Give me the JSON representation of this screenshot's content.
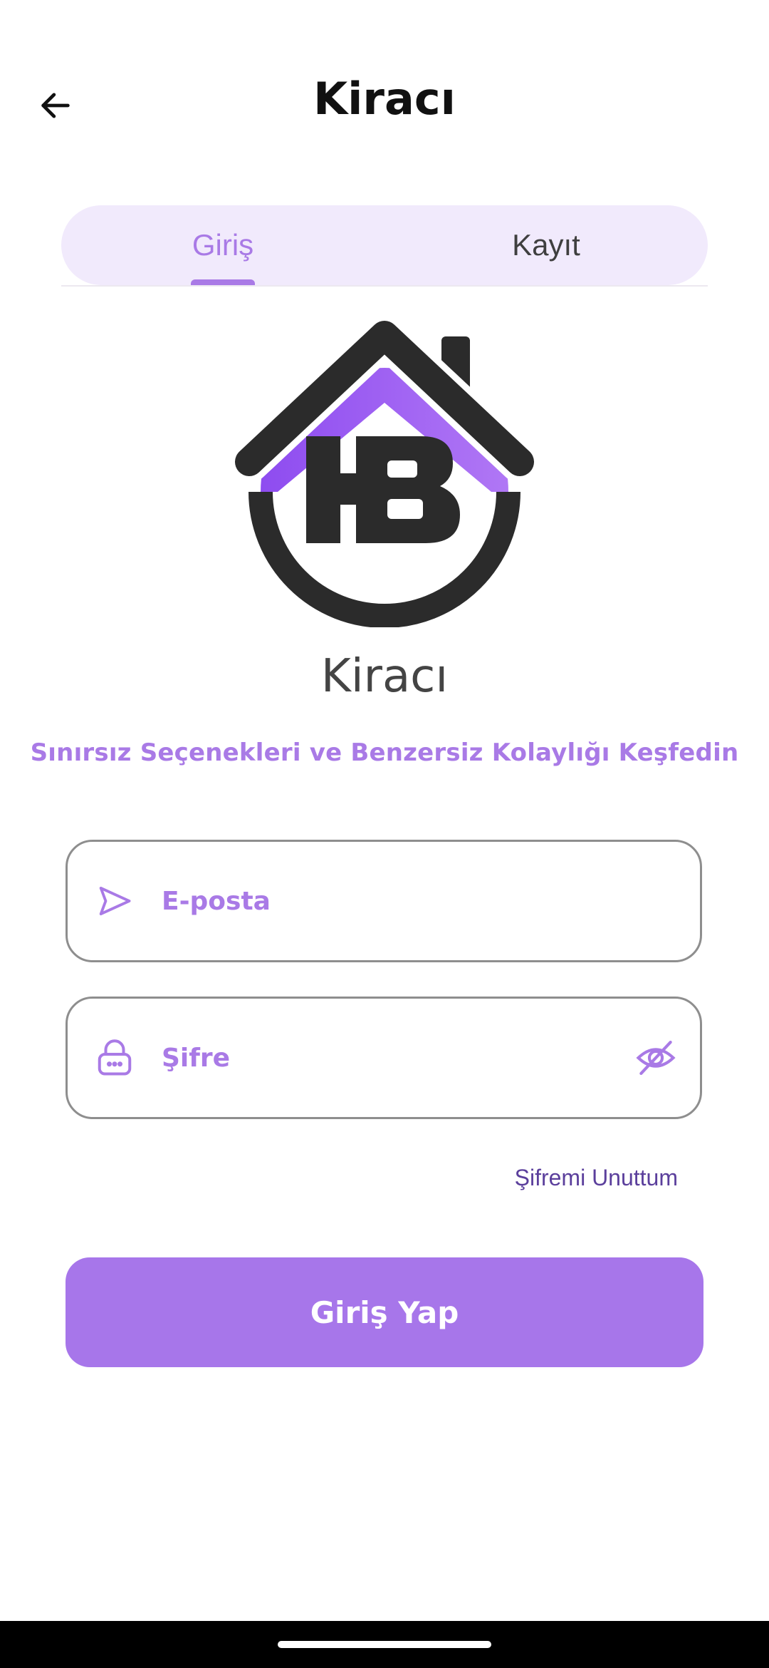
{
  "header": {
    "title": "Kiracı",
    "back_icon": "arrow-left-icon"
  },
  "tabs": [
    {
      "label": "Giriş",
      "active": true
    },
    {
      "label": "Kayıt",
      "active": false
    }
  ],
  "logo": {
    "icon": "house-hb-logo",
    "colors": {
      "purple": "#9b59f0",
      "dark": "#2b2b2b"
    }
  },
  "app_name": "Kiracı",
  "tagline": "Sınırsız Seçenekleri ve Benzersiz Kolaylığı Keşfedin",
  "form": {
    "email": {
      "placeholder": "E-posta",
      "value": "",
      "icon": "send-icon"
    },
    "password": {
      "placeholder": "Şifre",
      "value": "",
      "icon": "lock-icon",
      "toggle_icon": "eye-off-icon"
    },
    "forgot_label": "Şifremi Unuttum",
    "submit_label": "Giriş Yap"
  },
  "colors": {
    "accent": "#a776ea",
    "tab_bg": "#f1eafc",
    "link": "#5b3f9c"
  }
}
